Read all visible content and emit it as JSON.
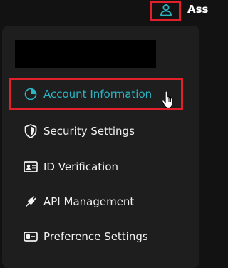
{
  "header": {
    "user_label": "Ass",
    "user_icon": "user-icon"
  },
  "menu": {
    "items": [
      {
        "label": "Account Information",
        "icon": "pie-chart-icon",
        "active": true
      },
      {
        "label": "Security Settings",
        "icon": "shield-icon",
        "active": false
      },
      {
        "label": "ID Verification",
        "icon": "id-card-icon",
        "active": false
      },
      {
        "label": "API Management",
        "icon": "plug-icon",
        "active": false
      },
      {
        "label": "Preference Settings",
        "icon": "toggle-icon",
        "active": false
      }
    ]
  },
  "colors": {
    "accent": "#2bb4c4",
    "highlight": "#e0202a",
    "background": "#121212",
    "menu_bg": "#1e1e1e"
  }
}
